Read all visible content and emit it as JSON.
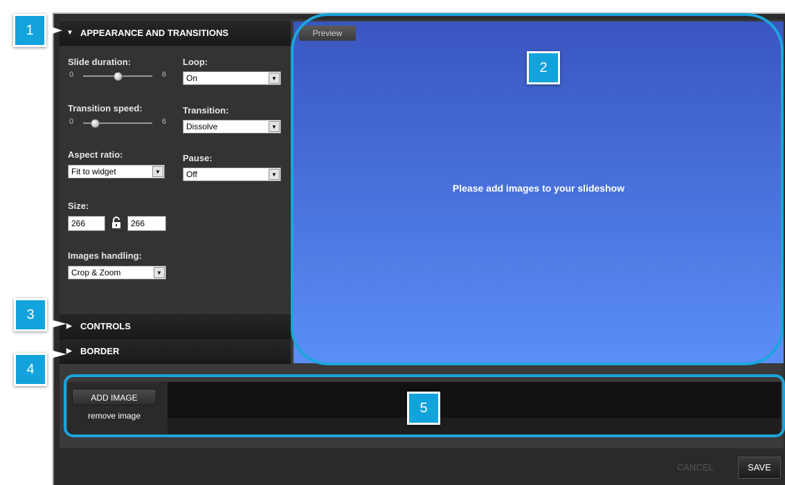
{
  "sections": {
    "appearance": "APPEARANCE AND TRANSITIONS",
    "controls": "CONTROLS",
    "border": "BORDER"
  },
  "settings": {
    "slide_duration": {
      "label": "Slide duration:",
      "min": "0",
      "max": "6",
      "value": 3
    },
    "transition_speed": {
      "label": "Transition speed:",
      "min": "0",
      "max": "6",
      "value": 1
    },
    "loop": {
      "label": "Loop:",
      "value": "On"
    },
    "transition": {
      "label": "Transition:",
      "value": "Dissolve"
    },
    "aspect_ratio": {
      "label": "Aspect ratio:",
      "value": "Fit to widget"
    },
    "pause": {
      "label": "Pause:",
      "value": "Off"
    },
    "size": {
      "label": "Size:",
      "width": "266",
      "height": "266"
    },
    "images_handling": {
      "label": "Images handling:",
      "value": "Crop & Zoom"
    }
  },
  "preview": {
    "button": "Preview",
    "message": "Please add images to your slideshow",
    "gradient": [
      "#3a55c0",
      "#5b8ff5"
    ]
  },
  "images": {
    "add_label": "ADD IMAGE",
    "remove_label": "remove image"
  },
  "footer": {
    "cancel": "CANCEL",
    "save": "SAVE"
  },
  "callouts": [
    "1",
    "2",
    "3",
    "4",
    "5"
  ],
  "colors": {
    "callout": "#12a3dc",
    "ring": "#1aa6dc"
  }
}
